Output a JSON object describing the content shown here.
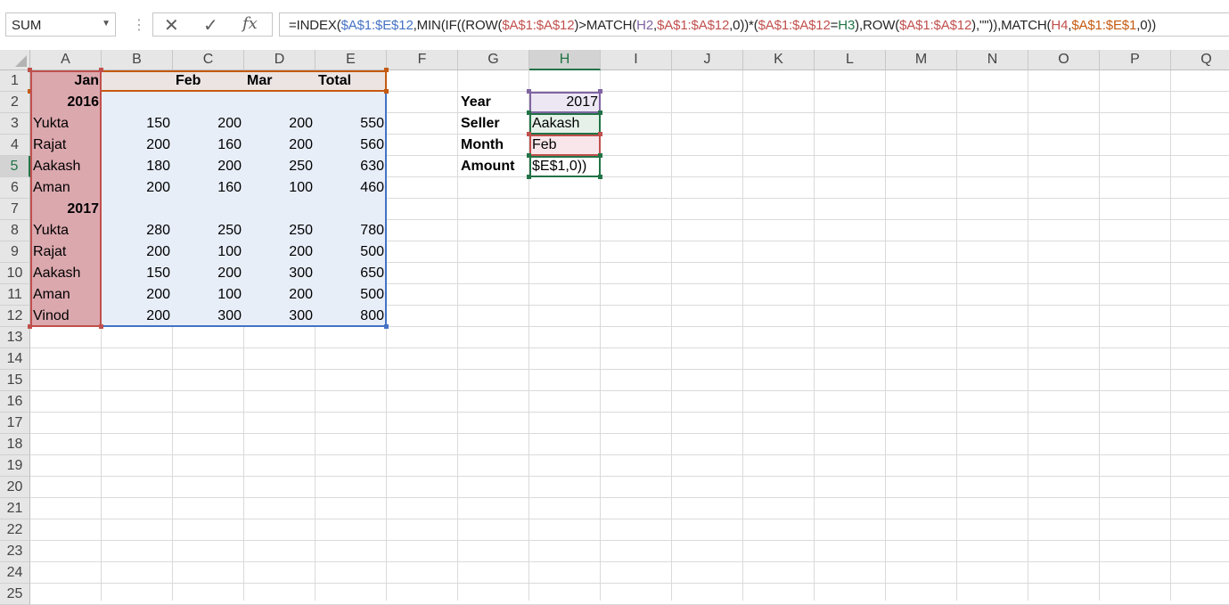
{
  "formula_bar": {
    "name_box": "SUM",
    "fx_label": "fx",
    "formula_parts": [
      {
        "t": "=INDEX(",
        "c": "#262626"
      },
      {
        "t": "$A$1:$E$12",
        "c": "#4472c4"
      },
      {
        "t": ",MIN(IF((ROW(",
        "c": "#262626"
      },
      {
        "t": "$A$1:$A$12",
        "c": "#c0504d"
      },
      {
        "t": ")>MATCH(",
        "c": "#262626"
      },
      {
        "t": "H2",
        "c": "#8064a2"
      },
      {
        "t": ",",
        "c": "#262626"
      },
      {
        "t": "$A$1:$A$12",
        "c": "#c0504d"
      },
      {
        "t": ",0))*(",
        "c": "#262626"
      },
      {
        "t": "$A$1:$A$12",
        "c": "#c0504d"
      },
      {
        "t": "=",
        "c": "#262626"
      },
      {
        "t": "H3",
        "c": "#217346"
      },
      {
        "t": "),ROW(",
        "c": "#262626"
      },
      {
        "t": "$A$1:$A$12",
        "c": "#c0504d"
      },
      {
        "t": "),\"\")),MATCH(",
        "c": "#262626"
      },
      {
        "t": "H4",
        "c": "#c0504d"
      },
      {
        "t": ",",
        "c": "#262626"
      },
      {
        "t": "$A$1:$E$1",
        "c": "#c55a11"
      },
      {
        "t": ",0))",
        "c": "#262626"
      }
    ]
  },
  "columns": [
    "A",
    "B",
    "C",
    "D",
    "E",
    "F",
    "G",
    "H",
    "I",
    "J",
    "K",
    "L",
    "M",
    "N",
    "O",
    "P",
    "Q"
  ],
  "rows": [
    "1",
    "2",
    "3",
    "4",
    "5",
    "6",
    "7",
    "8",
    "9",
    "10",
    "11",
    "12",
    "13",
    "14",
    "15",
    "16",
    "17",
    "18",
    "19",
    "20",
    "21",
    "22",
    "23",
    "24",
    "25"
  ],
  "cells": [
    {
      "ref": "A1",
      "v": "Jan",
      "cls": "bold right"
    },
    {
      "ref": "B1",
      "v": "",
      "cls": "bold"
    },
    {
      "ref": "C1",
      "v": "Feb",
      "cls": "bold"
    },
    {
      "ref": "D1",
      "v": "Mar",
      "cls": "bold"
    },
    {
      "ref": "E1",
      "v": "Total",
      "cls": "bold"
    },
    {
      "ref": "A2",
      "v": "2016",
      "cls": "bold right"
    },
    {
      "ref": "A3",
      "v": "Yukta"
    },
    {
      "ref": "B3",
      "v": "150",
      "cls": "num"
    },
    {
      "ref": "C3",
      "v": "200",
      "cls": "num"
    },
    {
      "ref": "D3",
      "v": "200",
      "cls": "num"
    },
    {
      "ref": "E3",
      "v": "550",
      "cls": "num"
    },
    {
      "ref": "A4",
      "v": "Rajat"
    },
    {
      "ref": "B4",
      "v": "200",
      "cls": "num"
    },
    {
      "ref": "C4",
      "v": "160",
      "cls": "num"
    },
    {
      "ref": "D4",
      "v": "200",
      "cls": "num"
    },
    {
      "ref": "E4",
      "v": "560",
      "cls": "num"
    },
    {
      "ref": "A5",
      "v": "Aakash"
    },
    {
      "ref": "B5",
      "v": "180",
      "cls": "num"
    },
    {
      "ref": "C5",
      "v": "200",
      "cls": "num"
    },
    {
      "ref": "D5",
      "v": "250",
      "cls": "num"
    },
    {
      "ref": "E5",
      "v": "630",
      "cls": "num"
    },
    {
      "ref": "A6",
      "v": "Aman"
    },
    {
      "ref": "B6",
      "v": "200",
      "cls": "num"
    },
    {
      "ref": "C6",
      "v": "160",
      "cls": "num"
    },
    {
      "ref": "D6",
      "v": "100",
      "cls": "num"
    },
    {
      "ref": "E6",
      "v": "460",
      "cls": "num"
    },
    {
      "ref": "A7",
      "v": "2017",
      "cls": "bold right"
    },
    {
      "ref": "A8",
      "v": "Yukta"
    },
    {
      "ref": "B8",
      "v": "280",
      "cls": "num"
    },
    {
      "ref": "C8",
      "v": "250",
      "cls": "num"
    },
    {
      "ref": "D8",
      "v": "250",
      "cls": "num"
    },
    {
      "ref": "E8",
      "v": "780",
      "cls": "num"
    },
    {
      "ref": "A9",
      "v": "Rajat"
    },
    {
      "ref": "B9",
      "v": "200",
      "cls": "num"
    },
    {
      "ref": "C9",
      "v": "100",
      "cls": "num"
    },
    {
      "ref": "D9",
      "v": "200",
      "cls": "num"
    },
    {
      "ref": "E9",
      "v": "500",
      "cls": "num"
    },
    {
      "ref": "A10",
      "v": "Aakash"
    },
    {
      "ref": "B10",
      "v": "150",
      "cls": "num"
    },
    {
      "ref": "C10",
      "v": "200",
      "cls": "num"
    },
    {
      "ref": "D10",
      "v": "300",
      "cls": "num"
    },
    {
      "ref": "E10",
      "v": "650",
      "cls": "num"
    },
    {
      "ref": "A11",
      "v": "Aman"
    },
    {
      "ref": "B11",
      "v": "200",
      "cls": "num"
    },
    {
      "ref": "C11",
      "v": "100",
      "cls": "num"
    },
    {
      "ref": "D11",
      "v": "200",
      "cls": "num"
    },
    {
      "ref": "E11",
      "v": "500",
      "cls": "num"
    },
    {
      "ref": "A12",
      "v": "Vinod"
    },
    {
      "ref": "B12",
      "v": "200",
      "cls": "num"
    },
    {
      "ref": "C12",
      "v": "300",
      "cls": "num"
    },
    {
      "ref": "D12",
      "v": "300",
      "cls": "num"
    },
    {
      "ref": "E12",
      "v": "800",
      "cls": "num"
    },
    {
      "ref": "G2",
      "v": "Year",
      "cls": "bold"
    },
    {
      "ref": "H2",
      "v": "2017",
      "cls": "num"
    },
    {
      "ref": "G3",
      "v": "Seller",
      "cls": "bold"
    },
    {
      "ref": "H3",
      "v": "Aakash"
    },
    {
      "ref": "G4",
      "v": "Month",
      "cls": "bold"
    },
    {
      "ref": "H4",
      "v": "Feb"
    },
    {
      "ref": "G5",
      "v": "Amount",
      "cls": "bold"
    },
    {
      "ref": "H5",
      "v": "$E$1,0))"
    }
  ],
  "colors": {
    "range_blue": "#4472c4",
    "range_blue_fill": "#e8eef8",
    "range_red": "#c0504d",
    "range_red_fill": "#dba8ae",
    "range_orange": "#c55a11",
    "range_purple": "#8064a2",
    "range_purple_fill": "#ede7f4",
    "range_green": "#217346",
    "range_green_fill": "#e6f2e9",
    "range_pink": "#c0504d",
    "range_pink_fill": "#f9e6ea"
  }
}
